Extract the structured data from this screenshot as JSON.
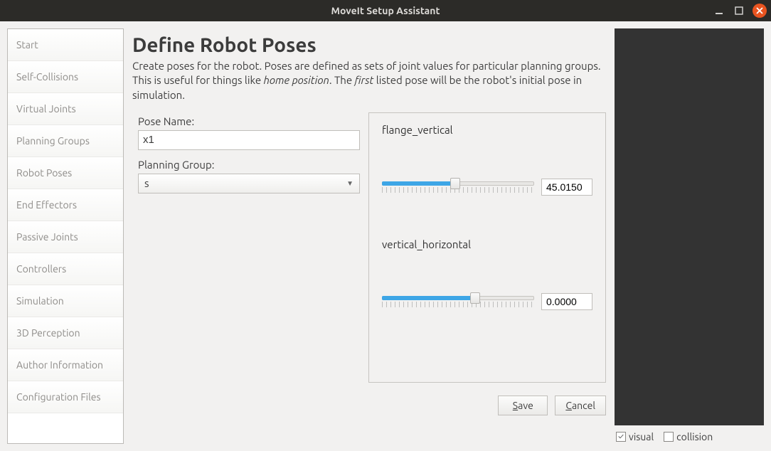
{
  "window": {
    "title": "MoveIt Setup Assistant"
  },
  "sidebar": {
    "items": [
      {
        "label": "Start"
      },
      {
        "label": "Self-Collisions"
      },
      {
        "label": "Virtual Joints"
      },
      {
        "label": "Planning Groups"
      },
      {
        "label": "Robot Poses"
      },
      {
        "label": "End Effectors"
      },
      {
        "label": "Passive Joints"
      },
      {
        "label": "Controllers"
      },
      {
        "label": "Simulation"
      },
      {
        "label": "3D Perception"
      },
      {
        "label": "Author Information"
      },
      {
        "label": "Configuration Files"
      }
    ]
  },
  "page": {
    "title": "Define Robot Poses",
    "desc_pre": "Create poses for the robot. Poses are defined as sets of joint values for particular planning groups. This is useful for things like ",
    "desc_em1": "home position",
    "desc_mid": ". The ",
    "desc_em2": "first",
    "desc_post": " listed pose will be the robot's initial pose in simulation."
  },
  "form": {
    "pose_name_label": "Pose Name:",
    "pose_name_value": "x1",
    "planning_group_label": "Planning Group:",
    "planning_group_value": "s"
  },
  "joints": [
    {
      "name": "flange_vertical",
      "value": "45.0150",
      "pos_class": "half"
    },
    {
      "name": "vertical_horizontal",
      "value": "0.0000",
      "pos_class": "mid"
    }
  ],
  "buttons": {
    "save": "Save",
    "cancel": "Cancel"
  },
  "preview": {
    "visual_label": "visual",
    "visual_checked": true,
    "collision_label": "collision",
    "collision_checked": false
  }
}
